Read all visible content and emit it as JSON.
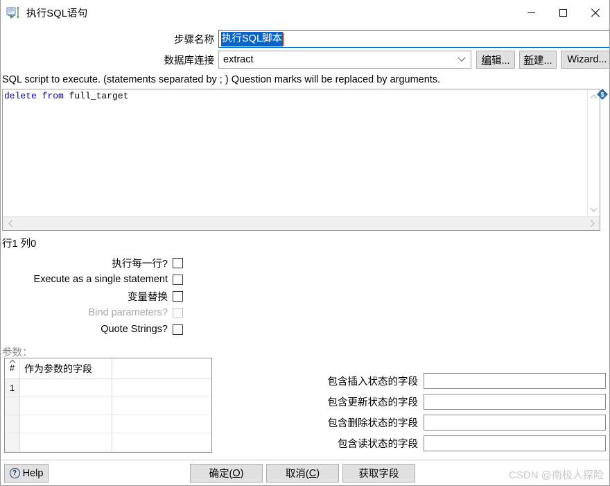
{
  "window": {
    "title": "执行SQL语句",
    "icon": "sql-script-icon",
    "controls": {
      "minimize": "minimize-icon",
      "maximize": "maximize-icon",
      "close": "close-icon"
    }
  },
  "form": {
    "step_name_label": "步骤名称",
    "step_name_value": "执行SQL脚本",
    "connection_label": "数据库连接",
    "connection_value": "extract",
    "edit_button": "编辑...",
    "edit_button_mnemonic": "编",
    "new_button": "新建...",
    "new_button_mnemonic": "新",
    "wizard_button": "Wizard..."
  },
  "editor": {
    "description": "SQL script to execute. (statements separated by ; ) Question marks will be replaced by arguments.",
    "sql_keywords": "delete from ",
    "sql_identifier": "full_target",
    "variable_icon": "dollar-diamond-icon",
    "caret_position": "行1 列0"
  },
  "checkboxes": [
    {
      "label": "执行每一行?",
      "checked": false,
      "disabled": false
    },
    {
      "label": "Execute as a single statement",
      "checked": false,
      "disabled": false
    },
    {
      "label": "变量替换",
      "checked": false,
      "disabled": false
    },
    {
      "label": "Bind parameters?",
      "checked": false,
      "disabled": true
    },
    {
      "label": "Quote Strings?",
      "checked": false,
      "disabled": false
    }
  ],
  "parameters": {
    "label": "参数：",
    "columns": [
      "#",
      "作为参数的字段",
      ""
    ],
    "rows": [
      {
        "num": "1",
        "field": ""
      },
      {
        "num": "",
        "field": ""
      },
      {
        "num": "",
        "field": ""
      },
      {
        "num": "",
        "field": ""
      },
      {
        "num": "",
        "field": ""
      }
    ]
  },
  "status_fields": [
    {
      "label": "包含插入状态的字段",
      "value": ""
    },
    {
      "label": "包含更新状态的字段",
      "value": ""
    },
    {
      "label": "包含删除状态的字段",
      "value": ""
    },
    {
      "label": "包含读状态的字段",
      "value": ""
    }
  ],
  "footer": {
    "help_label": "Help",
    "help_icon": "question-circle-icon",
    "ok_label": "确定(O)",
    "ok_prefix": "确定(",
    "ok_mnemonic": "O",
    "ok_suffix": ")",
    "cancel_prefix": "取消(",
    "cancel_mnemonic": "C",
    "cancel_suffix": ")",
    "get_fields_label": "获取字段",
    "watermark": "CSDN @南极人探险"
  },
  "colors": {
    "accent": "#0078d7",
    "selection": "#0a64c8",
    "caret": "#e07b28",
    "keyword": "#0000cc",
    "watermark": "#c9c9c9"
  }
}
